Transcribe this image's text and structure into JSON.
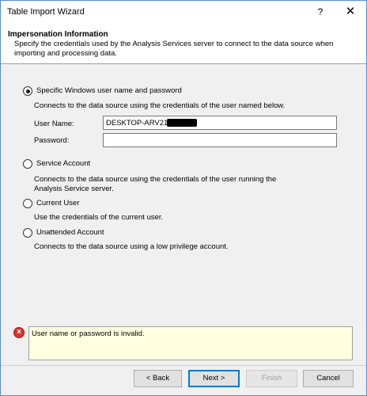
{
  "window": {
    "title": "Table Import Wizard",
    "help_label": "?",
    "close_label": "✕"
  },
  "header": {
    "title": "Impersonation Information",
    "description": "Specify the credentials used by the Analysis Services server to connect to the data source when importing and processing data."
  },
  "options": {
    "specific": {
      "label": "Specific Windows user name and password",
      "description": "Connects to the data source using the credentials of the user named below.",
      "selected": true
    },
    "username": {
      "label": "User Name:",
      "value": "DESKTOP-ARV21GR"
    },
    "password": {
      "label": "Password:",
      "value": ""
    },
    "service": {
      "label": "Service Account",
      "description": "Connects to the data source using the credentials of the user running the Analysis Service server."
    },
    "current": {
      "label": "Current User",
      "description": "Use the credentials of the current user."
    },
    "unattended": {
      "label": "Unattended Account",
      "description": "Connects to the data source using a low privilege account."
    }
  },
  "error": {
    "icon": "error-icon",
    "message": "User name or password is invalid."
  },
  "buttons": {
    "back": "< Back",
    "next": "Next >",
    "finish": "Finish",
    "cancel": "Cancel"
  }
}
